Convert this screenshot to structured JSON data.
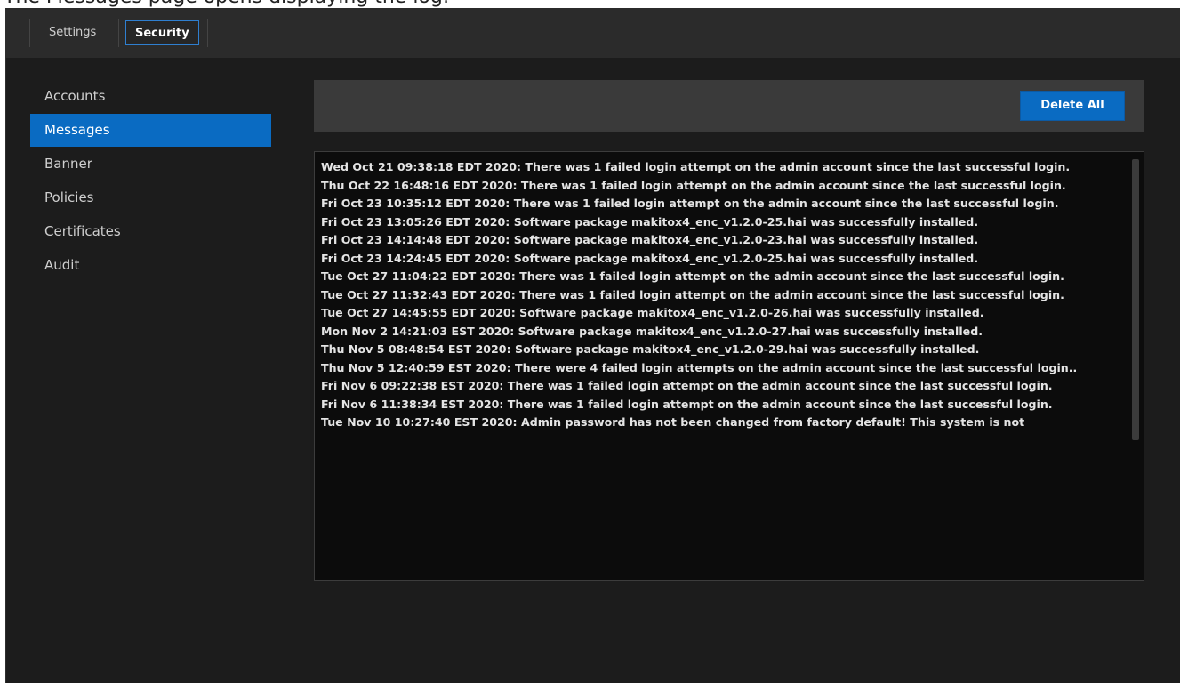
{
  "caption": "The Messages page opens displaying the log:",
  "tabs": [
    {
      "label": "Settings",
      "active": false
    },
    {
      "label": "Security",
      "active": true
    }
  ],
  "sidebar": {
    "items": [
      {
        "label": "Accounts",
        "active": false
      },
      {
        "label": "Messages",
        "active": true
      },
      {
        "label": "Banner",
        "active": false
      },
      {
        "label": "Policies",
        "active": false
      },
      {
        "label": "Certificates",
        "active": false
      },
      {
        "label": "Audit",
        "active": false
      }
    ]
  },
  "toolbar": {
    "delete_all_label": "Delete All"
  },
  "log": {
    "lines": [
      "Wed Oct 21 09:38:18 EDT 2020: There was 1 failed login attempt on the admin account since the last successful login.",
      "Thu Oct 22 16:48:16 EDT 2020: There was 1 failed login attempt on the admin account since the last successful login.",
      "Fri Oct 23 10:35:12 EDT 2020: There was 1 failed login attempt on the admin account since the last successful login.",
      "Fri Oct 23 13:05:26 EDT 2020: Software package makitox4_enc_v1.2.0-25.hai was successfully installed.",
      "Fri Oct 23 14:14:48 EDT 2020: Software package makitox4_enc_v1.2.0-23.hai was successfully installed.",
      "Fri Oct 23 14:24:45 EDT 2020: Software package makitox4_enc_v1.2.0-25.hai was successfully installed.",
      "Tue Oct 27 11:04:22 EDT 2020: There was 1 failed login attempt on the admin account since the last successful login.",
      "Tue Oct 27 11:32:43 EDT 2020: There was 1 failed login attempt on the admin account since the last successful login.",
      "Tue Oct 27 14:45:55 EDT 2020: Software package makitox4_enc_v1.2.0-26.hai was successfully installed.",
      "Mon Nov 2 14:21:03 EST 2020: Software package makitox4_enc_v1.2.0-27.hai was successfully installed.",
      "Thu Nov 5 08:48:54 EST 2020: Software package makitox4_enc_v1.2.0-29.hai was successfully installed.",
      "Thu Nov 5 12:40:59 EST 2020: There were 4 failed login attempts on the admin account since the last successful login..",
      "Fri Nov 6 09:22:38 EST 2020: There was 1 failed login attempt on the admin account since the last successful login.",
      "Fri Nov 6 11:38:34 EST 2020: There was 1 failed login attempt on the admin account since the last successful login.",
      "Tue Nov 10 10:27:40 EST 2020: Admin password has not been changed from factory default! This system is not"
    ]
  },
  "colors": {
    "accent": "#0a6bc2",
    "background": "#1c1c1c",
    "topbar": "#2b2b2b",
    "log_background": "#0c0c0c"
  }
}
